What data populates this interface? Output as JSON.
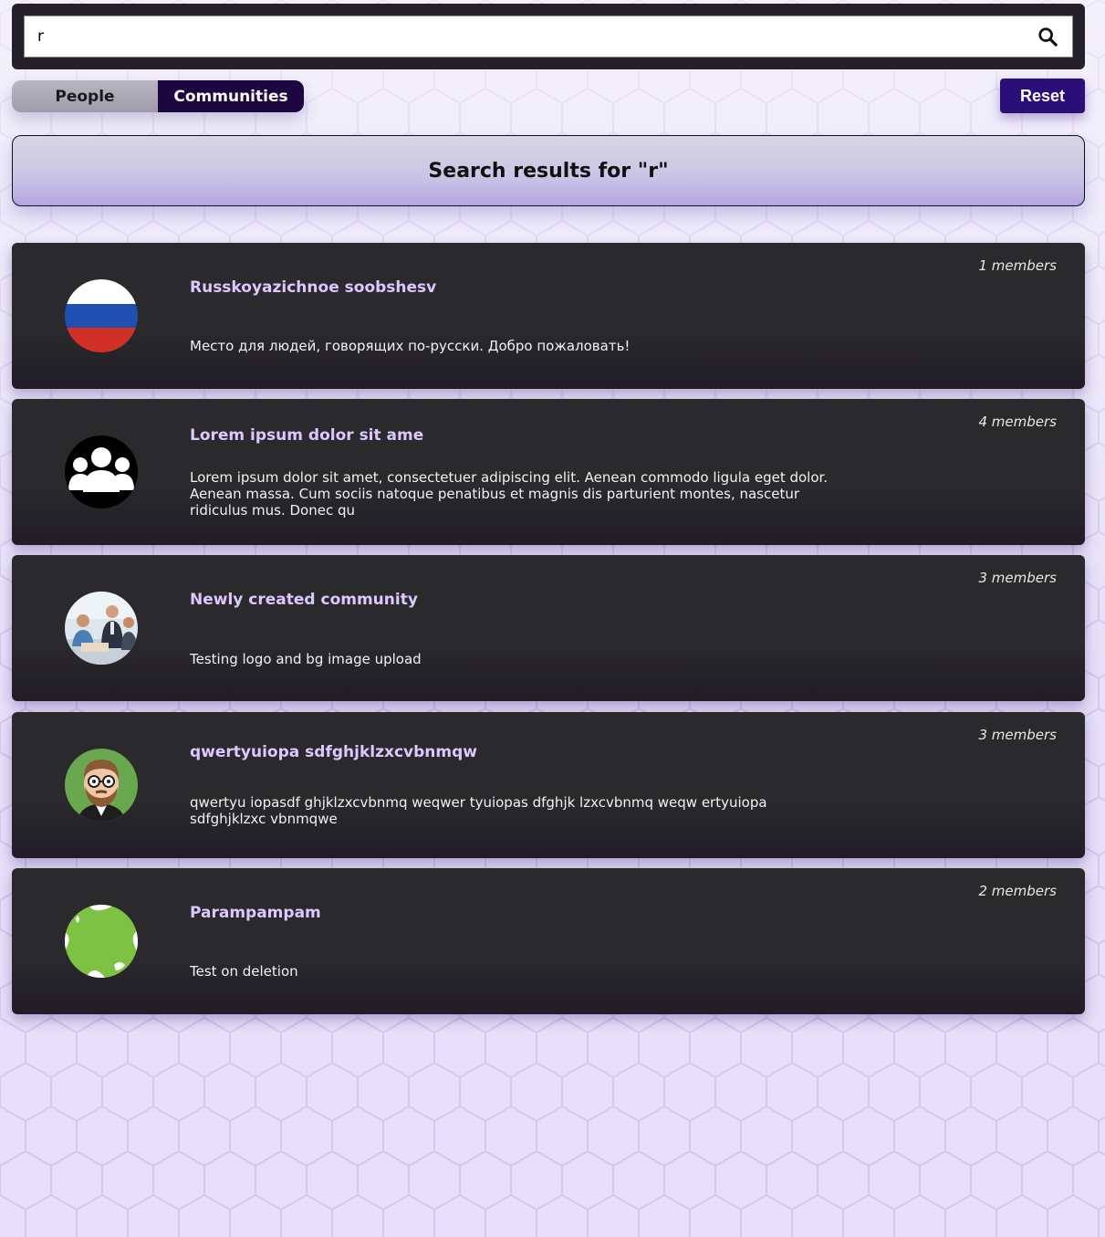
{
  "search": {
    "value": "r"
  },
  "tabs": {
    "people_label": "People",
    "communities_label": "Communities",
    "active": "Communities"
  },
  "reset_label": "Reset",
  "results": {
    "title": "Search results for \"r\""
  },
  "communities": [
    {
      "name": "Russkoyazichnoe soobshesv",
      "description": "Место для людей, говорящих по-русски. Добро пожаловать!",
      "members": "1 members",
      "avatar_icon": "russia-flag-icon"
    },
    {
      "name": "Lorem ipsum dolor sit ame",
      "description": "Lorem ipsum dolor sit amet, consectetuer adipiscing elit. Aenean commodo ligula eget dolor. Aenean massa. Cum sociis natoque penatibus et magnis dis parturient montes, nascetur ridiculus mus. Donec qu",
      "members": "4 members",
      "avatar_icon": "group-icon"
    },
    {
      "name": "Newly created community",
      "description": "Testing logo and bg image upload",
      "members": "3 members",
      "avatar_icon": "business-people-photo"
    },
    {
      "name": "qwertyuiopa sdfghjklzxcvbnmqw",
      "description": "qwertyu iopasdf ghjklzxcvbnmq weqwer tyuiopas dfghjk lzxcvbnmq weqw ertyuiopa sdfghjklzxc vbnmqwe",
      "members": "3 members",
      "avatar_icon": "bearded-man-avatar"
    },
    {
      "name": "Parampampam",
      "description": "Test on deletion",
      "members": "2 members",
      "avatar_icon": "green-globe-icon"
    }
  ],
  "colors": {
    "accent": "#2b0f78",
    "card_bg": "#2a292c",
    "title_text": "#dcc8ff"
  }
}
